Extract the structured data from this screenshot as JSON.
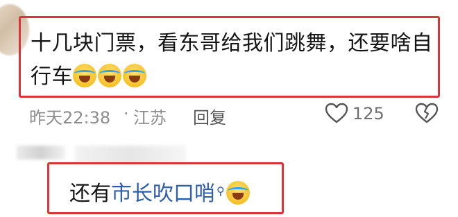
{
  "comment": {
    "text_line1": "十几块门票，看东哥给我们跳舞，还要啥自",
    "text_line2": "行车",
    "emoji": "laughing-crying-emoji"
  },
  "meta": {
    "time": "昨天22:38",
    "separator": "·",
    "location": "江苏",
    "reply_label": "回复",
    "like_count": "125"
  },
  "reply": {
    "prefix": "还有",
    "link_text": "市长吹口哨",
    "emoji": "laughing-crying-emoji"
  },
  "colors": {
    "highlight_box": "#d9363b",
    "link": "#2f5fa8",
    "meta_text": "#8c8c8c"
  }
}
